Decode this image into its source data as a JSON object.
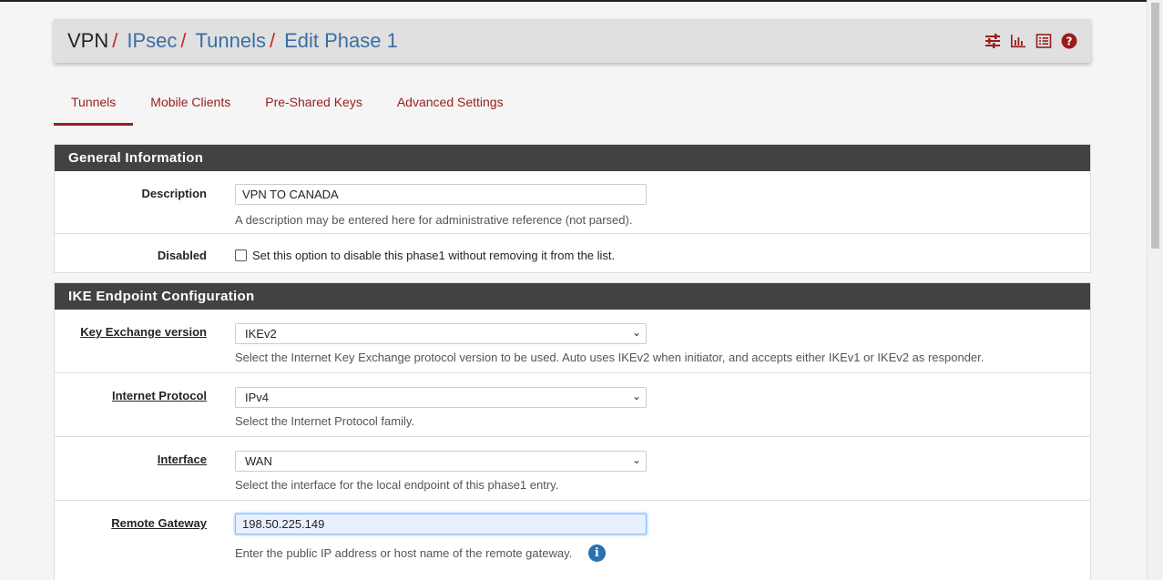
{
  "breadcrumb": {
    "items": [
      "VPN",
      "IPsec",
      "Tunnels",
      "Edit Phase 1"
    ],
    "separator": "/"
  },
  "header_icons": [
    "settings-sliders-icon",
    "bar-chart-icon",
    "list-icon",
    "help-icon"
  ],
  "tabs": [
    {
      "label": "Tunnels",
      "active": true
    },
    {
      "label": "Mobile Clients",
      "active": false
    },
    {
      "label": "Pre-Shared Keys",
      "active": false
    },
    {
      "label": "Advanced Settings",
      "active": false
    }
  ],
  "general": {
    "heading": "General Information",
    "description": {
      "label": "Description",
      "value": "VPN TO CANADA",
      "help": "A description may be entered here for administrative reference (not parsed)."
    },
    "disabled": {
      "label": "Disabled",
      "checked": false,
      "text": "Set this option to disable this phase1 without removing it from the list."
    }
  },
  "ike": {
    "heading": "IKE Endpoint Configuration",
    "key_exchange": {
      "label": "Key Exchange version",
      "value": "IKEv2",
      "help": "Select the Internet Key Exchange protocol version to be used. Auto uses IKEv2 when initiator, and accepts either IKEv1 or IKEv2 as responder."
    },
    "protocol": {
      "label": "Internet Protocol",
      "value": "IPv4",
      "help": "Select the Internet Protocol family."
    },
    "interface": {
      "label": "Interface",
      "value": "WAN",
      "help": "Select the interface for the local endpoint of this phase1 entry."
    },
    "remote_gateway": {
      "label": "Remote Gateway",
      "value": "198.50.225.149",
      "help": "Enter the public IP address or host name of the remote gateway."
    }
  },
  "colors": {
    "accent": "#9b1c1c",
    "panel_heading": "#424242",
    "link": "#3a6ea5",
    "info": "#2a6fb0"
  }
}
